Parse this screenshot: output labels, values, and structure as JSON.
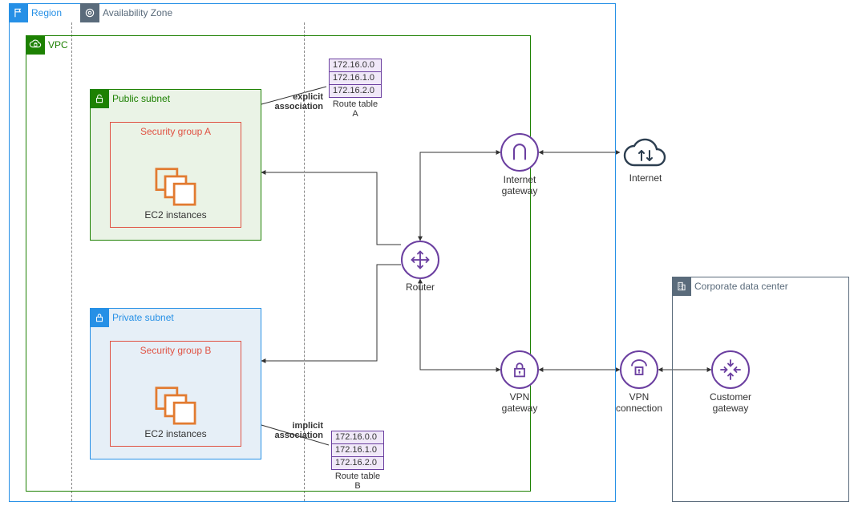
{
  "region": {
    "label": "Region"
  },
  "availability_zone": {
    "label": "Availability Zone"
  },
  "vpc": {
    "label": "VPC"
  },
  "public_subnet": {
    "label": "Public subnet",
    "security_group": {
      "title": "Security group A",
      "contents_label": "EC2 instances"
    },
    "association_label": "explicit\nassociation",
    "route_table": {
      "label": "Route table A",
      "rows": [
        "172.16.0.0",
        "172.16.1.0",
        "172.16.2.0"
      ]
    }
  },
  "private_subnet": {
    "label": "Private subnet",
    "security_group": {
      "title": "Security group B",
      "contents_label": "EC2 instances"
    },
    "association_label": "implicit\nassociation",
    "route_table": {
      "label": "Route table B",
      "rows": [
        "172.16.0.0",
        "172.16.1.0",
        "172.16.2.0"
      ]
    }
  },
  "router": {
    "label": "Router"
  },
  "internet_gateway": {
    "label": "Internet\ngateway"
  },
  "internet": {
    "label": "Internet"
  },
  "vpn_gateway": {
    "label": "VPN\ngateway"
  },
  "vpn_connection": {
    "label": "VPN\nconnection"
  },
  "customer_gateway": {
    "label": "Customer\ngateway"
  },
  "corporate_data_center": {
    "label": "Corporate data center"
  },
  "colors": {
    "region": "#2690e6",
    "vpc": "#1d8102",
    "az": "#5a6b7b",
    "purple": "#6b3fa0",
    "orange": "#e27b31",
    "red": "#e05243"
  }
}
